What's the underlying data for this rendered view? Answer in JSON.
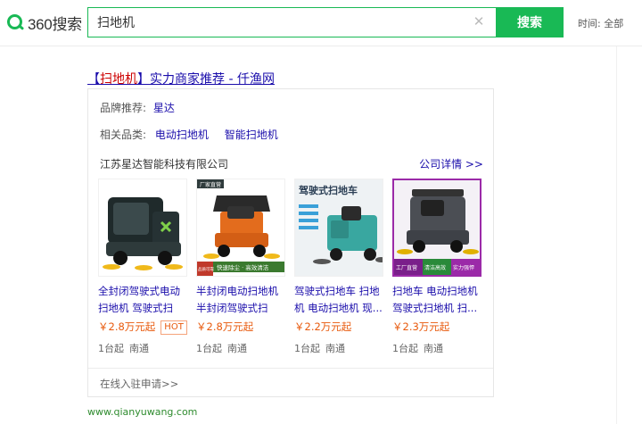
{
  "header": {
    "logo_text": "360搜索",
    "search_value": "扫地机",
    "search_button": "搜索",
    "time_filter": "时间: 全部"
  },
  "result": {
    "title_prefix": "【",
    "title_highlight": "扫地机",
    "title_suffix": "】实力商家推荐 - 仟渔网",
    "brand_label": "品牌推荐:",
    "brand_value": "星达",
    "related_label": "相关品类:",
    "related_items": [
      "电动扫地机",
      "智能扫地机"
    ],
    "company": "江苏星达智能科技有限公司",
    "company_link": "公司详情 >>",
    "apply_link": "在线入驻申请>>",
    "site_url": "www.qianyuwang.com"
  },
  "products": [
    {
      "name": "全封闭驾驶式电动扫地机 驾驶式扫地...",
      "price": "￥2.8万元起",
      "badge": "HOT",
      "moq": "1台起",
      "location": "南通"
    },
    {
      "name": "半封闭电动扫地机 半封闭驾驶式扫地...",
      "price": "￥2.8万元起",
      "badge": "",
      "moq": "1台起",
      "location": "南通",
      "img_tag_top": "厂家直营",
      "img_tag_bottom": "快速除尘 · 高效清洁",
      "img_tag_corner": "品质可靠"
    },
    {
      "name": "驾驶式扫地车 扫地机 电动扫地机 现...",
      "price": "￥2.2万元起",
      "badge": "",
      "moq": "1台起",
      "location": "南通",
      "img_title": "驾驶式扫地车"
    },
    {
      "name": "扫地车 电动扫地机 驾驶式扫地机 扫...",
      "price": "￥2.3万元起",
      "badge": "",
      "moq": "1台起",
      "location": "南通",
      "img_tag_left": "工厂直营",
      "img_tag_mid": "清洁高效",
      "img_tag_right": "实力强悍"
    }
  ],
  "colors": {
    "brand_green": "#19b955",
    "link_blue": "#1a0dab",
    "price_orange": "#e8590c",
    "highlight_red": "#cc0000",
    "url_green": "#2e8b2e"
  }
}
